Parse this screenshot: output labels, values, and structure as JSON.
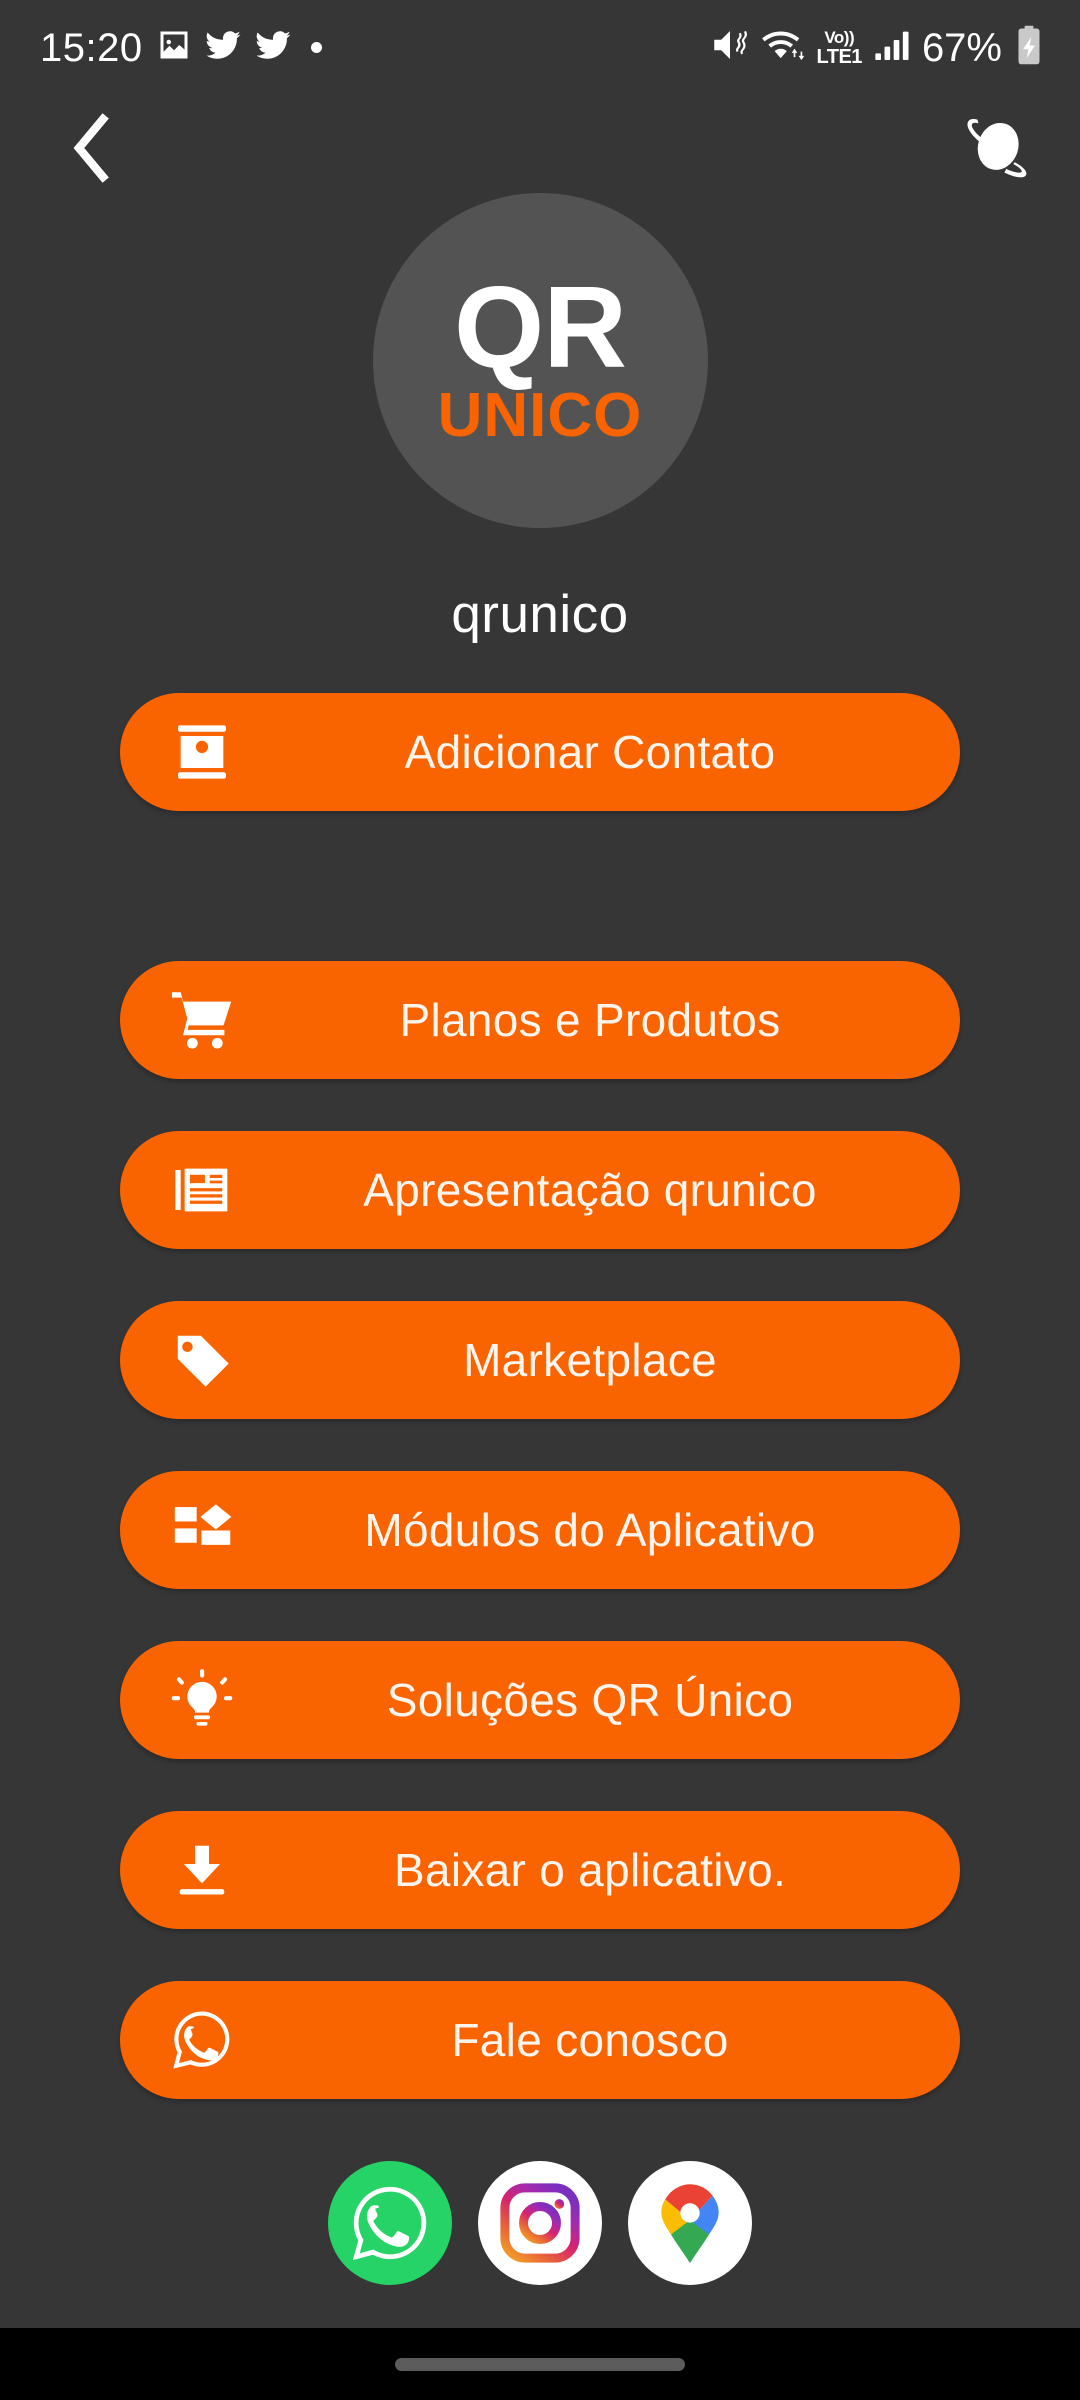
{
  "status_bar": {
    "clock": "15:20",
    "battery_percent": "67%",
    "network_label_top": "Vo))",
    "network_label_bottom": "LTE1",
    "left_icons": [
      "image-icon",
      "twitter-icon",
      "twitter-icon",
      "dot-icon"
    ],
    "right_icons": [
      "vibrate-mute-icon",
      "wifi-icon",
      "volte-icon",
      "signal-bars-icon",
      "battery-charging-icon"
    ]
  },
  "header": {
    "back_icon": "chevron-left-icon",
    "menu_icon": "planet-icon"
  },
  "profile": {
    "logo_primary": "QR",
    "logo_secondary": "UNICO",
    "username": "qrunico"
  },
  "buttons": [
    {
      "label": "Adicionar Contato",
      "icon": "contact-card-icon"
    },
    {
      "label": "Planos e Produtos",
      "icon": "shopping-cart-icon"
    },
    {
      "label": "Apresentação qrunico",
      "icon": "article-icon"
    },
    {
      "label": "Marketplace",
      "icon": "price-tag-icon"
    },
    {
      "label": "Módulos do Aplicativo",
      "icon": "modules-icon"
    },
    {
      "label": "Soluções QR Único",
      "icon": "lightbulb-icon"
    },
    {
      "label": "Baixar o aplicativo.",
      "icon": "download-icon"
    },
    {
      "label": "Fale conosco",
      "icon": "whatsapp-outline-icon"
    }
  ],
  "social_links": [
    {
      "name": "whatsapp-icon",
      "label": "WhatsApp"
    },
    {
      "name": "instagram-icon",
      "label": "Instagram"
    },
    {
      "name": "google-maps-icon",
      "label": "Google Maps"
    }
  ],
  "colors": {
    "background": "#363636",
    "accent": "#F96400",
    "logo_circle": "#535353",
    "button_text": "#fdf4ee",
    "whatsapp_green": "#25D366",
    "nav_bar": "#000000"
  }
}
